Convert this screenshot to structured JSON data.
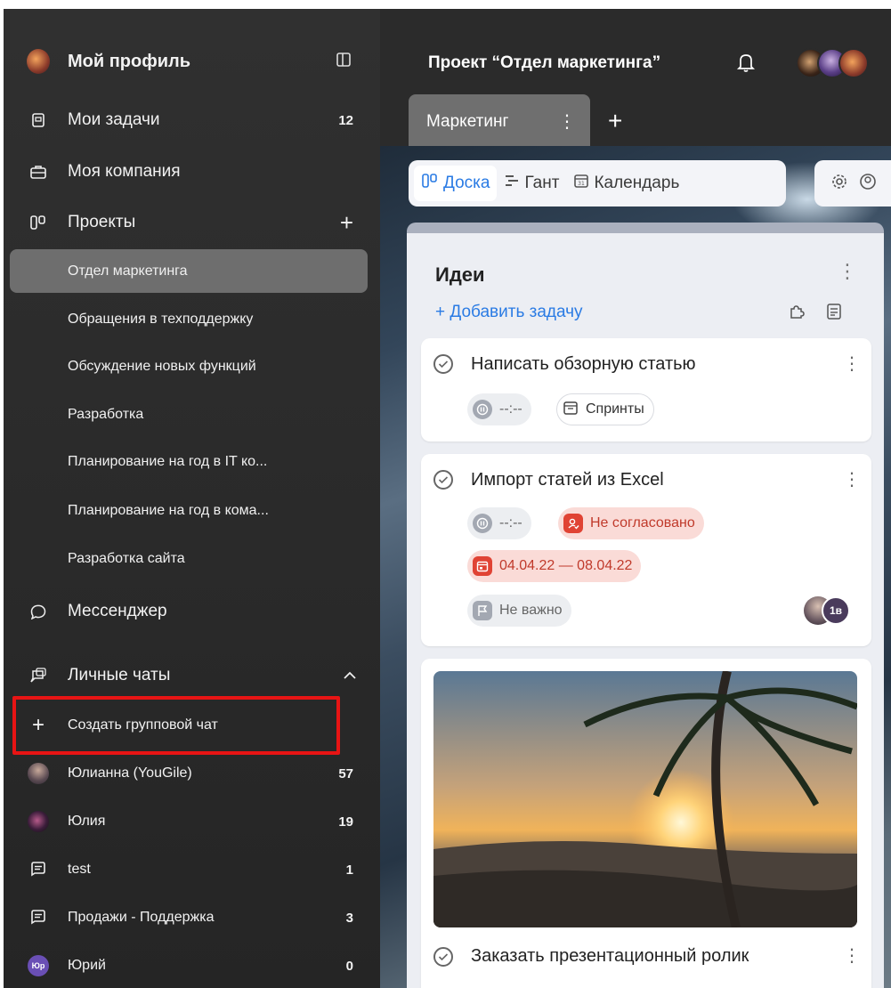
{
  "sidebar": {
    "profile": {
      "label": "Мой профиль"
    },
    "my_tasks": {
      "label": "Мои задачи",
      "count": "12"
    },
    "my_company": {
      "label": "Моя компания"
    },
    "projects": {
      "label": "Проекты"
    },
    "project_list": [
      "Отдел маркетинга",
      "Обращения в техподдержку",
      "Обсуждение новых функций",
      "Разработка",
      "Планирование на год в IT ко...",
      "Планирование на год в кома...",
      "Разработка сайта"
    ],
    "messenger": {
      "label": "Мессенджер"
    },
    "personal_chats": {
      "label": "Личные чаты"
    },
    "create_group_chat": {
      "label": "Создать групповой чат"
    },
    "chats": [
      {
        "name": "Юлианна (YouGile)",
        "count": "57"
      },
      {
        "name": "Юлия",
        "count": "19"
      },
      {
        "name": "test",
        "count": "1"
      },
      {
        "name": "Продажи - Поддержка",
        "count": "3"
      },
      {
        "name": "Юрий",
        "count": "0",
        "avatar_text": "Юр"
      }
    ],
    "highlight_color": "#e81414"
  },
  "header": {
    "project_title": "Проект “Отдел маркетинга”"
  },
  "tabs": [
    {
      "label": "Маркетинг",
      "more": "⋮"
    }
  ],
  "views": [
    {
      "label": "Доска",
      "icon": "board-icon",
      "active": true
    },
    {
      "label": "Гант",
      "icon": "gantt-icon",
      "active": false
    },
    {
      "label": "Календарь",
      "icon": "calendar-icon",
      "active": false
    }
  ],
  "column": {
    "title": "Идеи",
    "add_task": "+ Добавить задачу",
    "cards": [
      {
        "title": "Написать обзорную статью",
        "timer": "--:--",
        "sprint": "Спринты"
      },
      {
        "title": "Импорт статей из Excel",
        "timer": "--:--",
        "status": "Не согласовано",
        "dates": "04.04.22 — 08.04.22",
        "priority": "Не важно",
        "assignee_initials": "1в"
      },
      {
        "title": "Заказать презентационный ролик"
      }
    ]
  },
  "colors": {
    "accent": "#2a7be4",
    "sidebar_bg": "#2b2b2b",
    "active_item": "#6e6e6e",
    "danger_chip": "#fadbd7",
    "danger_text": "#c03a2b"
  }
}
